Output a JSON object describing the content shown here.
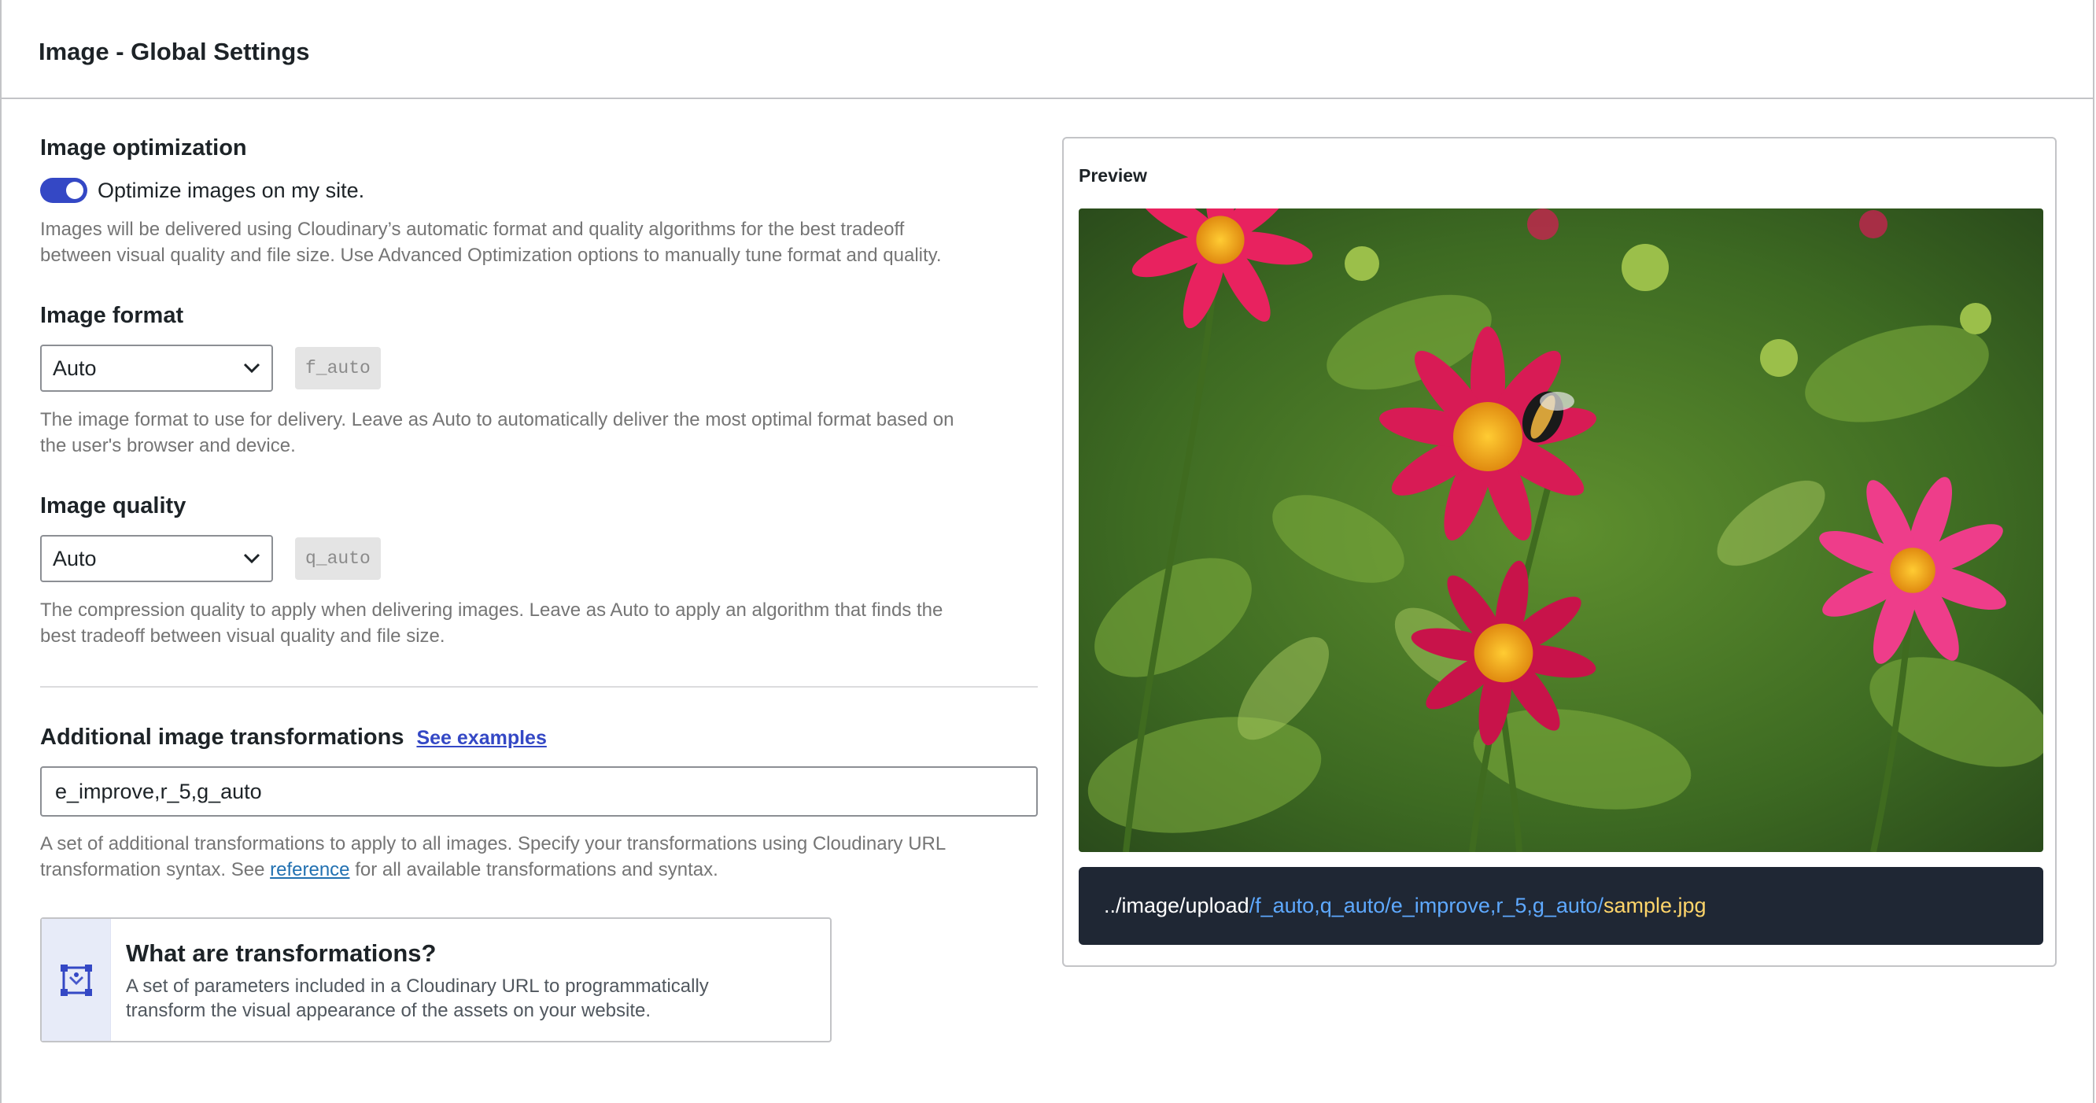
{
  "header": {
    "title": "Image - Global Settings"
  },
  "optimization": {
    "title": "Image optimization",
    "toggle_label": "Optimize images on my site.",
    "toggle_on": true,
    "help_line1": "Images will be delivered using Cloudinary’s automatic format and quality algorithms for the best tradeoff",
    "help_line2": "between visual quality and file size. Use Advanced Optimization options to manually tune format and quality."
  },
  "format": {
    "title": "Image format",
    "selected": "Auto",
    "code": "f_auto",
    "help_line1": "The image format to use for delivery. Leave as Auto to automatically deliver the most optimal format based on",
    "help_line2": "the user's browser and device."
  },
  "quality": {
    "title": "Image quality",
    "selected": "Auto",
    "code": "q_auto",
    "help_line1": "The compression quality to apply when delivering images. Leave as Auto to apply an algorithm that finds the",
    "help_line2": "best tradeoff between visual quality and file size."
  },
  "transformations": {
    "title": "Additional image transformations",
    "examples_link": "See examples",
    "value": "e_improve,r_5,g_auto",
    "help_line1": "A set of additional transformations to apply to all images. Specify your transformations using Cloudinary URL",
    "help_pre": "transformation syntax. See ",
    "help_link": "reference",
    "help_post": " for all available transformations and syntax."
  },
  "info_card": {
    "icon": "transform-icon",
    "title": "What are transformations?",
    "line1": "A set of parameters included in a Cloudinary URL to programmatically",
    "line2": "transform the visual appearance of the assets on your website."
  },
  "preview": {
    "title": "Preview",
    "image": "flowers-photo",
    "url_base": "../image/upload",
    "url_transforms": "/f_auto,q_auto/e_improve,r_5,g_auto/",
    "url_file": "sample.jpg"
  },
  "colors": {
    "accent": "#3448c5",
    "url_bar": "#1f2734",
    "url_transform": "#5ea9ff",
    "url_file": "#ffd56a"
  }
}
